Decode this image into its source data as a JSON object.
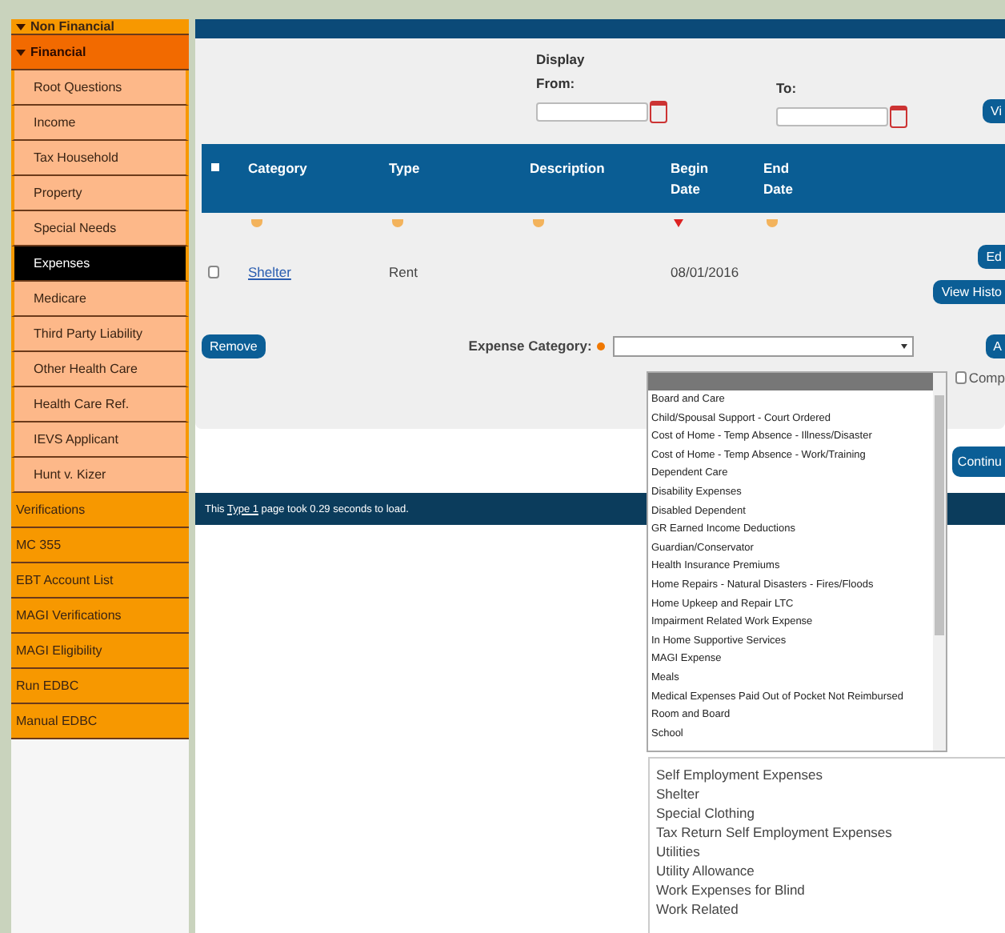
{
  "sidebar": {
    "items": [
      {
        "label": "Non Financial",
        "kind": "header",
        "expanded": true,
        "selected": false
      },
      {
        "label": "Financial",
        "kind": "open-header",
        "expanded": true,
        "selected": false
      },
      {
        "label": "Root Questions",
        "kind": "sub",
        "selected": false
      },
      {
        "label": "Income",
        "kind": "sub",
        "selected": false
      },
      {
        "label": "Tax Household",
        "kind": "sub",
        "selected": false
      },
      {
        "label": "Property",
        "kind": "sub",
        "selected": false
      },
      {
        "label": "Special Needs",
        "kind": "sub",
        "selected": false
      },
      {
        "label": "Expenses",
        "kind": "sub",
        "selected": true
      },
      {
        "label": "Medicare",
        "kind": "sub",
        "selected": false
      },
      {
        "label": "Third Party Liability",
        "kind": "sub",
        "selected": false
      },
      {
        "label": "Other Health Care",
        "kind": "sub",
        "selected": false
      },
      {
        "label": "Health Care Ref.",
        "kind": "sub",
        "selected": false
      },
      {
        "label": "IEVS Applicant",
        "kind": "sub",
        "selected": false
      },
      {
        "label": "Hunt v. Kizer",
        "kind": "sub",
        "selected": false
      },
      {
        "label": "Verifications",
        "kind": "link",
        "selected": false
      },
      {
        "label": "MC 355",
        "kind": "link",
        "selected": false
      },
      {
        "label": "EBT Account List",
        "kind": "link",
        "selected": false
      },
      {
        "label": "MAGI Verifications",
        "kind": "link",
        "selected": false
      },
      {
        "label": "MAGI Eligibility",
        "kind": "link",
        "selected": false
      },
      {
        "label": "Run EDBC",
        "kind": "link",
        "selected": false
      },
      {
        "label": "Manual EDBC",
        "kind": "link",
        "selected": false
      }
    ]
  },
  "display": {
    "heading": "Display",
    "from_label": "From:",
    "to_label": "To:"
  },
  "view_button": "Vi",
  "table": {
    "select_all_checked": false,
    "columns": [
      {
        "label": "Category",
        "sorted": false
      },
      {
        "label": "Type",
        "sorted": false
      },
      {
        "label": "Description",
        "sorted": false
      },
      {
        "label": "Begin Date",
        "sorted": true
      },
      {
        "label": "End Date",
        "sorted": false
      }
    ],
    "rows": [
      {
        "checked": false,
        "category": "Shelter",
        "type": "Rent",
        "begin_date": "08/01/2016"
      }
    ]
  },
  "row_buttons": [
    "Ed",
    "View Histo"
  ],
  "remove_button": "Remove",
  "expense_category": {
    "label": "Expense Category:",
    "required": true,
    "blank_highlighted": true,
    "options": [
      "Board and Care",
      "Child/Spousal Support - Court Ordered",
      "Cost of Home - Temp Absence - Illness/Disaster",
      "Cost of Home - Temp Absence - Work/Training",
      "Dependent Care",
      "Disability Expenses",
      "Disabled Dependent",
      "GR Earned Income Deductions",
      "Guardian/Conservator",
      "Health Insurance Premiums",
      "Home Repairs - Natural Disasters - Fires/Floods",
      "Home Upkeep and Repair LTC",
      "Impairment Related Work Expense",
      "In Home Supportive Services",
      "MAGI Expense",
      "Meals",
      "Medical Expenses Paid Out of Pocket Not Reimbursed",
      "Room and Board",
      "School"
    ]
  },
  "add_button": "A",
  "comp_checkbox": {
    "label": "Comp",
    "checked": false
  },
  "continue_button": "Continu",
  "footer": {
    "before": "This ",
    "link": "Type 1",
    "after": " page took 0.29 seconds to load."
  },
  "second_list": {
    "options": [
      "Self Employment Expenses",
      "Shelter",
      "Special Clothing",
      "Tax Return Self Employment Expenses",
      "Utilities",
      "Utility Allowance",
      "Work Expenses for Blind",
      "Work Related"
    ]
  }
}
